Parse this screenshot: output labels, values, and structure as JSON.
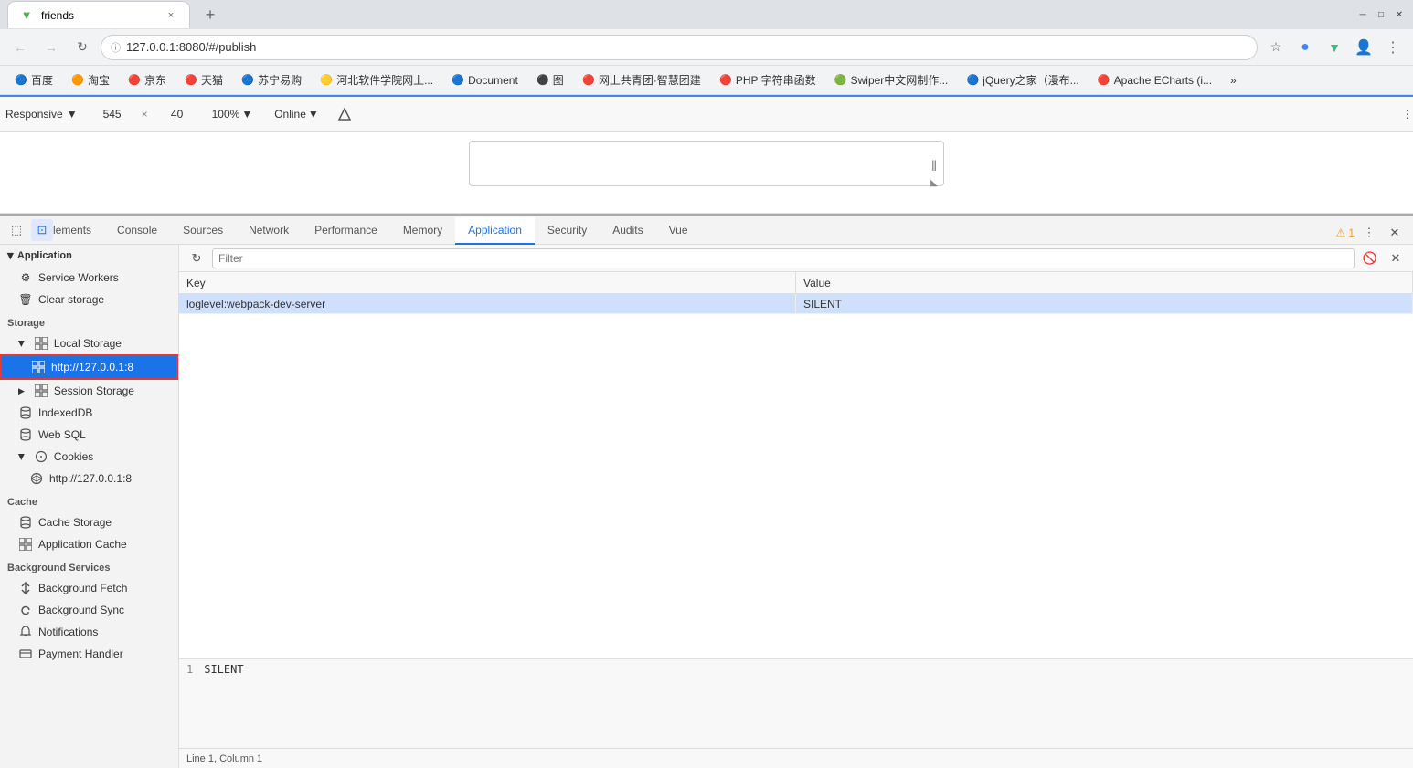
{
  "browser": {
    "tab_title": "friends",
    "url": "127.0.0.1:8080/#/publish",
    "new_tab_label": "+",
    "close_label": "×"
  },
  "bookmarks": [
    {
      "label": "百度",
      "icon": "🔵"
    },
    {
      "label": "淘宝",
      "icon": "🟠"
    },
    {
      "label": "京东",
      "icon": "🔴"
    },
    {
      "label": "天猫",
      "icon": "🔴"
    },
    {
      "label": "苏宁易购",
      "icon": "🔵"
    },
    {
      "label": "河北软件学院网上...",
      "icon": "🟡"
    },
    {
      "label": "Document",
      "icon": "🔵"
    },
    {
      "label": "图",
      "icon": "⚫"
    },
    {
      "label": "网上共青团·智慧团建",
      "icon": "🔴"
    },
    {
      "label": "PHP 字符串函数",
      "icon": "🔴"
    },
    {
      "label": "Swiper中文网制作...",
      "icon": "🟢"
    },
    {
      "label": "jQuery之家（漫布...",
      "icon": "🔵"
    },
    {
      "label": "Apache ECharts (i...",
      "icon": "🔴"
    },
    {
      "label": "»",
      "icon": ""
    }
  ],
  "responsive_bar": {
    "responsive_label": "Responsive",
    "width_value": "545",
    "height_value": "40",
    "zoom_label": "100%",
    "online_label": "Online"
  },
  "devtools": {
    "tabs": [
      {
        "label": "Elements",
        "active": false
      },
      {
        "label": "Console",
        "active": false
      },
      {
        "label": "Sources",
        "active": false
      },
      {
        "label": "Network",
        "active": false
      },
      {
        "label": "Performance",
        "active": false
      },
      {
        "label": "Memory",
        "active": false
      },
      {
        "label": "Application",
        "active": true
      },
      {
        "label": "Security",
        "active": false
      },
      {
        "label": "Audits",
        "active": false
      },
      {
        "label": "Vue",
        "active": false
      }
    ],
    "warning_count": "1",
    "sidebar": {
      "sections": [
        {
          "label": "Application",
          "items": [
            {
              "label": "Service Workers",
              "icon": "⚙",
              "type": "item"
            },
            {
              "label": "Clear storage",
              "icon": "🗑",
              "type": "item"
            }
          ]
        },
        {
          "label": "Storage",
          "items": [
            {
              "label": "Local Storage",
              "icon": "grid",
              "type": "expandable",
              "expanded": true
            },
            {
              "label": "http://127.0.0.1:8",
              "icon": "grid",
              "type": "sub",
              "active": true
            },
            {
              "label": "Session Storage",
              "icon": "grid",
              "type": "expandable",
              "expanded": false
            },
            {
              "label": "IndexedDB",
              "icon": "cylinder",
              "type": "item"
            },
            {
              "label": "Web SQL",
              "icon": "cylinder",
              "type": "item"
            },
            {
              "label": "Cookies",
              "icon": "cookie",
              "type": "expandable",
              "expanded": true
            },
            {
              "label": "http://127.0.0.1:8",
              "icon": "web",
              "type": "sub"
            }
          ]
        },
        {
          "label": "Cache",
          "items": [
            {
              "label": "Cache Storage",
              "icon": "cylinder",
              "type": "item"
            },
            {
              "label": "Application Cache",
              "icon": "grid",
              "type": "item"
            }
          ]
        },
        {
          "label": "Background Services",
          "items": [
            {
              "label": "Background Fetch",
              "icon": "↕",
              "type": "item"
            },
            {
              "label": "Background Sync",
              "icon": "↻",
              "type": "item"
            },
            {
              "label": "Notifications",
              "icon": "🔔",
              "type": "item"
            },
            {
              "label": "Payment Handler",
              "icon": "💳",
              "type": "item"
            }
          ]
        }
      ]
    },
    "filter_placeholder": "Filter",
    "table": {
      "columns": [
        "Key",
        "Value"
      ],
      "rows": [
        {
          "key": "loglevel:webpack-dev-server",
          "value": "SILENT"
        }
      ]
    },
    "bottom_value": "SILENT",
    "status_bar": "Line 1, Column 1"
  }
}
